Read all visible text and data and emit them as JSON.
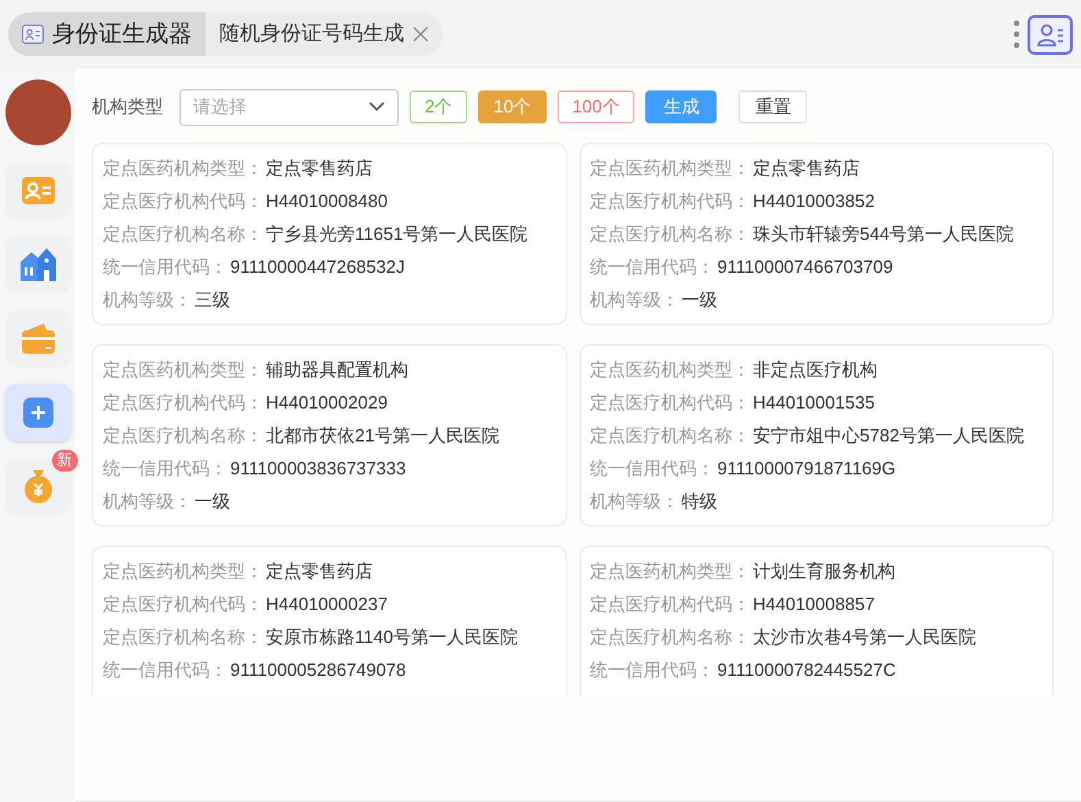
{
  "tabs": [
    {
      "label": "身份证生成器",
      "kind": "app",
      "selected": true
    },
    {
      "label": "随机身份证号码生成",
      "kind": "page",
      "selected": false
    }
  ],
  "sidebar": {
    "items": [
      {
        "kind": "card",
        "selected": false
      },
      {
        "kind": "house",
        "selected": false
      },
      {
        "kind": "wallet",
        "selected": false
      },
      {
        "kind": "plus",
        "selected": true
      },
      {
        "kind": "money",
        "selected": false,
        "badge": "新"
      }
    ]
  },
  "toolbar": {
    "label": "机构类型",
    "select": {
      "placeholder": "请选择"
    },
    "counts": [
      {
        "label": "2个",
        "color": "#67c23a",
        "selected": false
      },
      {
        "label": "10个",
        "color": "#e6a23c",
        "selected": true
      },
      {
        "label": "100个",
        "color": "#f56c6c",
        "selected": false
      }
    ],
    "generate": "生成",
    "reset": "重置"
  },
  "cards": [
    {
      "fields": [
        {
          "label": "定点医药机构类型：",
          "value": "定点零售药店"
        },
        {
          "label": "定点医疗机构代码：",
          "value": "H44010008480"
        },
        {
          "label": "定点医疗机构名称：",
          "value": "宁乡县光旁11651号第一人民医院"
        },
        {
          "label": "统一信用代码：",
          "value": "91110000447268532J"
        },
        {
          "label": "机构等级：",
          "value": "三级"
        }
      ]
    },
    {
      "fields": [
        {
          "label": "定点医药机构类型：",
          "value": "定点零售药店"
        },
        {
          "label": "定点医疗机构代码：",
          "value": "H44010003852"
        },
        {
          "label": "定点医疗机构名称：",
          "value": "珠头市轩辕旁544号第一人民医院"
        },
        {
          "label": "统一信用代码：",
          "value": "911100007466703709"
        },
        {
          "label": "机构等级：",
          "value": "一级"
        }
      ]
    },
    {
      "fields": [
        {
          "label": "定点医药机构类型：",
          "value": "辅助器具配置机构"
        },
        {
          "label": "定点医疗机构代码：",
          "value": "H44010002029"
        },
        {
          "label": "定点医疗机构名称：",
          "value": "北都市茯依21号第一人民医院"
        },
        {
          "label": "统一信用代码：",
          "value": "911100003836737333"
        },
        {
          "label": "机构等级：",
          "value": "一级"
        }
      ]
    },
    {
      "fields": [
        {
          "label": "定点医药机构类型：",
          "value": "非定点医疗机构"
        },
        {
          "label": "定点医疗机构代码：",
          "value": "H44010001535"
        },
        {
          "label": "定点医疗机构名称：",
          "value": "安宁市俎中心5782号第一人民医院"
        },
        {
          "label": "统一信用代码：",
          "value": "91110000791871169G"
        },
        {
          "label": "机构等级：",
          "value": "特级"
        }
      ]
    },
    {
      "fields": [
        {
          "label": "定点医药机构类型：",
          "value": "定点零售药店"
        },
        {
          "label": "定点医疗机构代码：",
          "value": "H44010000237"
        },
        {
          "label": "定点医疗机构名称：",
          "value": "安原市栋路1140号第一人民医院"
        },
        {
          "label": "统一信用代码：",
          "value": "911100005286749078"
        }
      ]
    },
    {
      "fields": [
        {
          "label": "定点医药机构类型：",
          "value": "计划生育服务机构"
        },
        {
          "label": "定点医疗机构代码：",
          "value": "H44010008857"
        },
        {
          "label": "定点医疗机构名称：",
          "value": "太沙市次巷4号第一人民医院"
        },
        {
          "label": "统一信用代码：",
          "value": "91110000782445527C"
        }
      ]
    }
  ]
}
